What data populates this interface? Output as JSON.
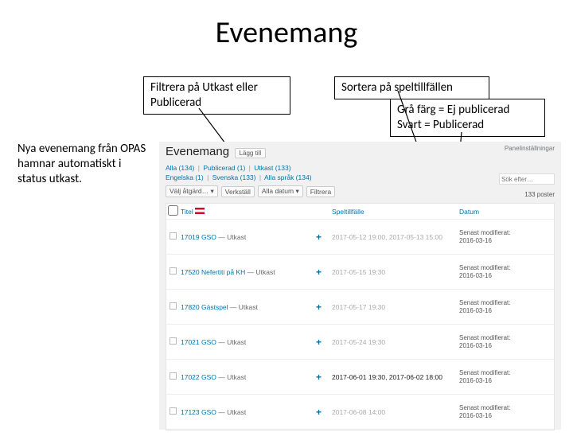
{
  "slide": {
    "title": "Evenemang",
    "callout_filter": "Filtrera på Utkast eller Publicerad",
    "callout_sort": "Sortera på speltillfällen",
    "callout_color": "Grå färg = Ej publicerad\nSvart = Publicerad",
    "side_note": "Nya evenemang från OPAS hamnar automatiskt i status utkast."
  },
  "sc": {
    "title": "Evenemang",
    "add_btn": "Lägg till",
    "panel_opts": "Panelinställningar",
    "filters_row1": {
      "alla": "Alla (134)",
      "pub": "Publicerad (1)",
      "utkast": "Utkast (133)"
    },
    "filters_row2": {
      "eng": "Engelska (1)",
      "swe": "Svenska (133)",
      "all_lang": "Alla språk (134)"
    },
    "action_sel": "Välj åtgärd…",
    "date_sel": "Alla datum",
    "verkstall": "Verkställ",
    "filtrera": "Filtrera",
    "search_ph": "Sök efter…",
    "count": "133 poster",
    "cols": {
      "titel": "Titel",
      "spel": "Speltillfälle",
      "datum": "Datum"
    },
    "rows": [
      {
        "title": "17019 GSO",
        "status": "— Utkast",
        "spel": "2017-05-12 19:00, 2017-05-13 15:00",
        "dark": false,
        "mod": "Senast modifierat: 2016-03-16"
      },
      {
        "title": "17520 Nefertiti på KH",
        "status": "— Utkast",
        "spel": "2017-05-15 19:30",
        "dark": false,
        "mod": "Senast modifierat: 2016-03-16"
      },
      {
        "title": "17820 Gästspel",
        "status": "— Utkast",
        "spel": "2017-05-17 19:30",
        "dark": false,
        "mod": "Senast modifierat: 2016-03-16"
      },
      {
        "title": "17021 GSO",
        "status": "— Utkast",
        "spel": "2017-05-24 19:30",
        "dark": false,
        "mod": "Senast modifierat: 2016-03-16"
      },
      {
        "title": "17022 GSO",
        "status": "— Utkast",
        "spel": "2017-06-01 19:30, 2017-06-02 18:00",
        "dark": true,
        "mod": "Senast modifierat: 2016-03-16"
      },
      {
        "title": "17123 GSO",
        "status": "— Utkast",
        "spel": "2017-06-08 14:00",
        "dark": false,
        "mod": "Senast modifierat: 2016-03-16"
      }
    ]
  }
}
